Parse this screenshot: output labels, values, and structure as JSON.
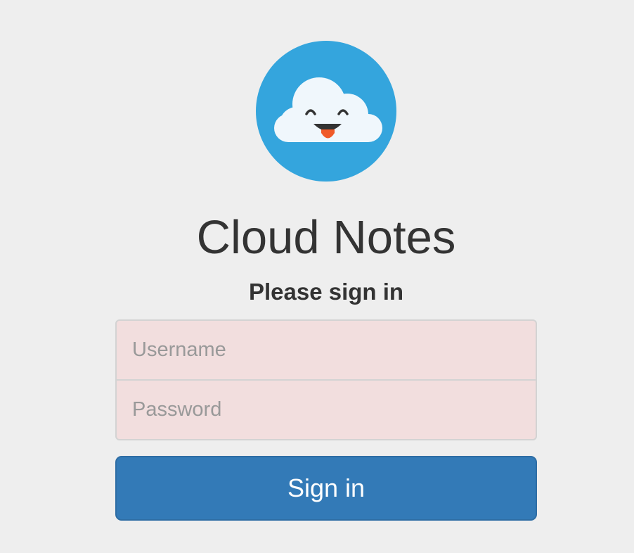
{
  "logo": {
    "icon": "smiling-cloud-icon",
    "circle_color": "#34a5dd",
    "cloud_color": "#f0f7fc",
    "tongue_color": "#f05a28"
  },
  "title": "Cloud Notes",
  "subtitle": "Please sign in",
  "form": {
    "username": {
      "placeholder": "Username",
      "value": ""
    },
    "password": {
      "placeholder": "Password",
      "value": ""
    },
    "field_background": "#f2dede",
    "submit_label": "Sign in",
    "submit_color": "#337ab7"
  }
}
